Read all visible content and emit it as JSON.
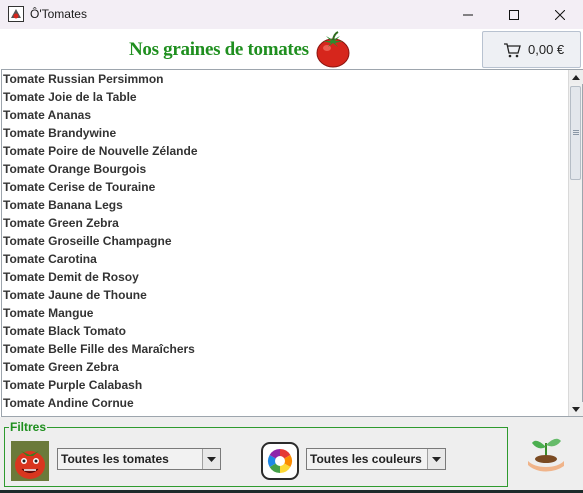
{
  "window": {
    "title": "Ô'Tomates",
    "icons": {
      "app": "app-icon",
      "minimize": "minimize-icon",
      "maximize": "maximize-icon",
      "close": "close-icon"
    }
  },
  "header": {
    "title": "Nos graines de tomates",
    "logo_icon": "tomato-icon",
    "cart": {
      "icon": "cart-icon",
      "total": "0,00 €"
    }
  },
  "products": [
    "Tomate Russian Persimmon",
    "Tomate Joie de la Table",
    "Tomate Ananas",
    "Tomate Brandywine",
    "Tomate Poire de Nouvelle Zélande",
    "Tomate Orange Bourgois",
    "Tomate Cerise de Touraine",
    "Tomate Banana Legs",
    "Tomate Green Zebra",
    "Tomate Groseille Champagne",
    "Tomate Carotina",
    "Tomate Demit de Rosoy",
    "Tomate Jaune de Thoune",
    "Tomate Mangue",
    "Tomate Black Tomato",
    "Tomate Belle Fille des Maraîchers",
    "Tomate Green Zebra",
    "Tomate Purple Calabash",
    "Tomate Andine Cornue"
  ],
  "filters": {
    "legend": "Filtres",
    "variety_select": {
      "value": "Toutes les tomates",
      "icon": "tomato-character-icon"
    },
    "color_select": {
      "value": "Toutes les couleurs",
      "icon": "color-wheel-icon"
    },
    "extra_icon": "seedling-in-hand-icon"
  },
  "colors": {
    "accent_green": "#1f8f1f",
    "tomato_red": "#d6261c",
    "list_text": "#333333"
  }
}
